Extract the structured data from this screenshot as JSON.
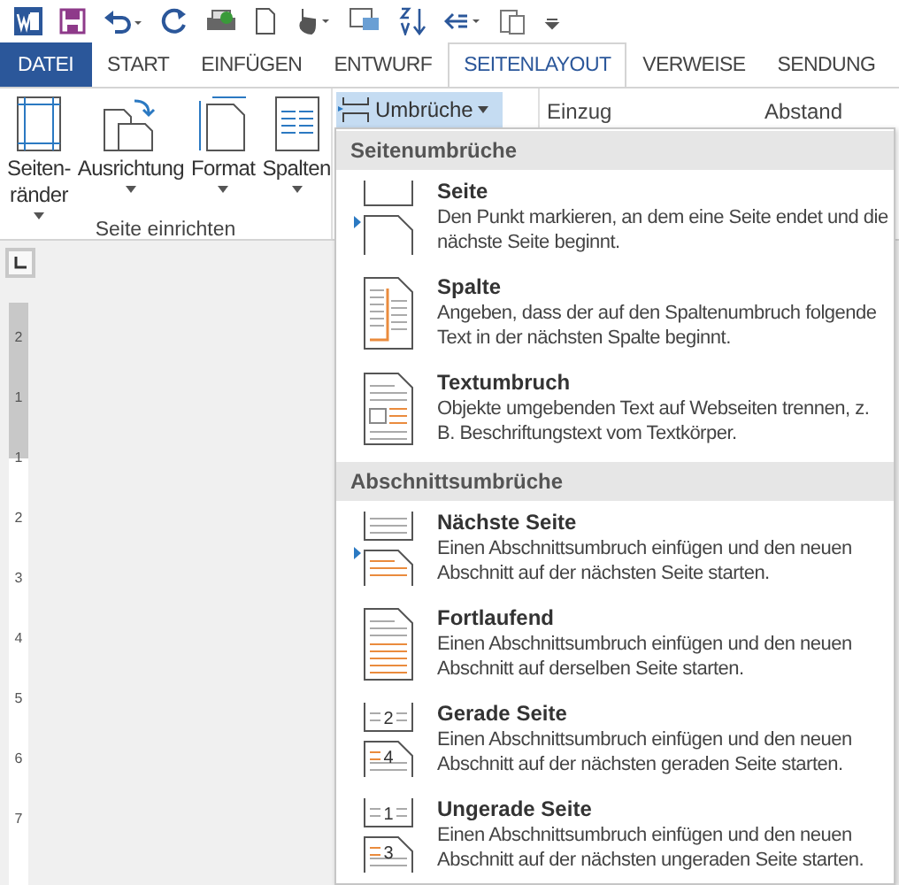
{
  "tabs": [
    {
      "label": "DATEI",
      "kind": "file",
      "selected": false
    },
    {
      "label": "START",
      "kind": "tab",
      "selected": false
    },
    {
      "label": "EINFÜGEN",
      "kind": "tab",
      "selected": false
    },
    {
      "label": "ENTWURF",
      "kind": "tab",
      "selected": false
    },
    {
      "label": "SEITENLAYOUT",
      "kind": "tab",
      "selected": true
    },
    {
      "label": "VERWEISE",
      "kind": "tab",
      "selected": false
    },
    {
      "label": "SENDUNG",
      "kind": "tab",
      "selected": false
    }
  ],
  "ribbon": {
    "buttons": [
      {
        "label": "Seiten-",
        "label2": "ränder",
        "kind": "margins"
      },
      {
        "label": "Ausrichtung",
        "kind": "orientation"
      },
      {
        "label": "Format",
        "kind": "size"
      },
      {
        "label": "Spalten",
        "kind": "columns"
      }
    ],
    "group_label": "Seite einrichten",
    "breaks_button": "Umbrüche",
    "indent_label": "Einzug",
    "spacing_label": "Abstand"
  },
  "ruler": {
    "labels": [
      "2",
      "1",
      "1",
      "2",
      "3",
      "4",
      "5",
      "6",
      "7"
    ]
  },
  "menu": {
    "sections": [
      {
        "title": "Seitenumbrüche",
        "items": [
          {
            "kind": "page",
            "title": "Seite",
            "description": "Den Punkt markieren, an dem eine Seite endet und die nächste Seite beginnt.",
            "pointer": true
          },
          {
            "kind": "column",
            "title": "Spalte",
            "description": "Angeben, dass der auf den Spaltenumbruch folgende Text in der nächsten Spalte beginnt.",
            "pointer": false
          },
          {
            "kind": "wrap",
            "title": "Textumbruch",
            "description": "Objekte umgebenden Text auf Webseiten trennen, z. B. Beschriftungstext vom Textkörper.",
            "pointer": false
          }
        ]
      },
      {
        "title": "Abschnittsumbrüche",
        "items": [
          {
            "kind": "next",
            "title": "Nächste Seite",
            "description": "Einen Abschnittsumbruch einfügen und den neuen Abschnitt auf der nächsten Seite starten.",
            "pointer": true
          },
          {
            "kind": "continuous",
            "title": "Fortlaufend",
            "description": "Einen Abschnittsumbruch einfügen und den neuen Abschnitt auf derselben Seite starten.",
            "pointer": false
          },
          {
            "kind": "even",
            "title": "Gerade Seite",
            "description": "Einen Abschnittsumbruch einfügen und den neuen Abschnitt auf der nächsten geraden Seite starten.",
            "pointer": false,
            "n1": "2",
            "n2": "4"
          },
          {
            "kind": "odd",
            "title": "Ungerade Seite",
            "description": "Einen Abschnittsumbruch einfügen und den neuen Abschnitt auf der nächsten ungeraden Seite starten.",
            "pointer": false,
            "n1": "1",
            "n2": "3"
          }
        ]
      }
    ]
  }
}
